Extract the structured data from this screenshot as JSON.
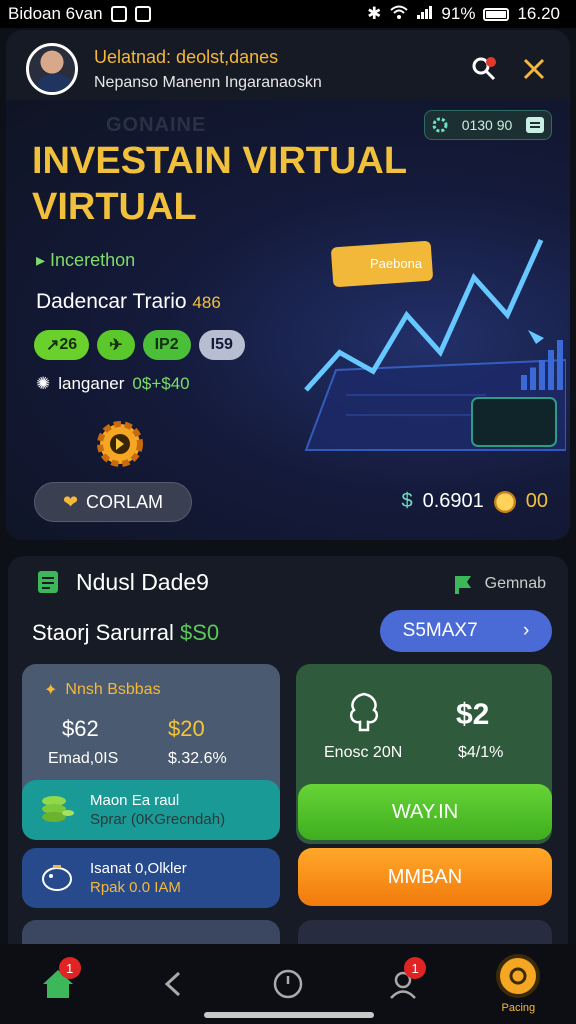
{
  "status_bar": {
    "left_text": "Bidoan 6van",
    "battery": "91%",
    "time": "16.20"
  },
  "header": {
    "title": "Uelatnad: deolst,danes",
    "subtitle": "Nepanso Manenn Ingaranaoskn"
  },
  "hero": {
    "ghost_text": "GONAINE",
    "badge_value": "0130 90",
    "title": "INVESTAIN VIRTUAL VIRTUAL",
    "tag": "Incerethon",
    "trade_label": "Dadencar Trario",
    "trade_value": "486",
    "chips": [
      "26",
      "",
      "IP2",
      "59"
    ],
    "lang_label": "langaner",
    "lang_value": "0$+$40",
    "panel_label": "Paebona",
    "corlam_label": "CORLAM",
    "balance": "0.6901",
    "coins": "00",
    "chart_data": {
      "type": "line",
      "series": [
        {
          "values": [
            1,
            3,
            2,
            5,
            3,
            7,
            5,
            9
          ]
        }
      ]
    }
  },
  "section": {
    "title": "Ndusl Dade9",
    "right_label": "Gemnab",
    "subtitle": "Staorj Sarurral",
    "subtitle_value": "$S0",
    "semax_label": "S5MAX7",
    "card_left": {
      "title": "Nnsh Bsbbas",
      "value1": "$62",
      "value2": "$20",
      "sub1": "Emad,0IS",
      "sub2": "$.32.6%"
    },
    "card_right": {
      "value": "$2",
      "sub1": "Enosc 20N",
      "sub2": "$4/1%"
    },
    "row_teal": {
      "line1": "Maon Ea raul",
      "line2": "Sprar (0KGrecndah)"
    },
    "row_blue": {
      "line1": "Isanat 0,Olkler",
      "line2": "Rpak 0.0 IAM"
    },
    "wayin_label": "WAY.IN",
    "mmban_label": "MMBAN"
  },
  "nav": {
    "home_badge": "1",
    "notif_badge": "1",
    "pacing_label": "Pacing"
  },
  "colors": {
    "accent_gold": "#f2c13c",
    "accent_green": "#5ac82b",
    "accent_orange": "#f27a0c",
    "accent_blue": "#4a6ad6"
  }
}
